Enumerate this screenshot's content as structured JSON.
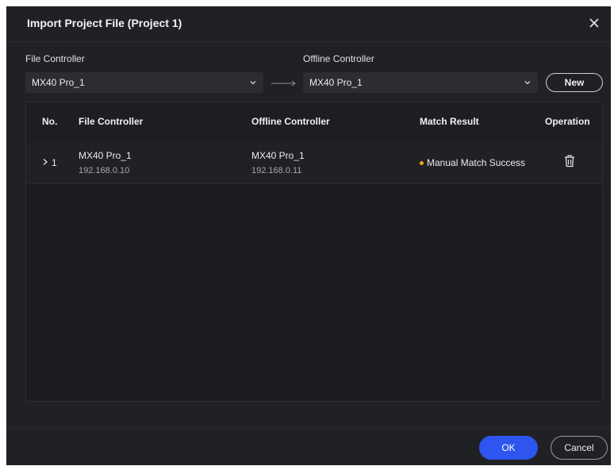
{
  "dialog": {
    "title": "Import Project File (Project 1)",
    "close_icon": "close-icon"
  },
  "file_controller": {
    "label": "File Controller",
    "selected": "MX40 Pro_1"
  },
  "offline_controller": {
    "label": "Offline Controller",
    "selected": "MX40 Pro_1"
  },
  "new_button": {
    "label": "New"
  },
  "table": {
    "headers": {
      "no": "No.",
      "file_controller": "File Controller",
      "offline_controller": "Offline Controller",
      "match_result": "Match Result",
      "operation": "Operation"
    },
    "rows": [
      {
        "no": "1",
        "file_controller_name": "MX40 Pro_1",
        "file_controller_ip": "192.168.0.10",
        "offline_controller_name": "MX40 Pro_1",
        "offline_controller_ip": "192.168.0.11",
        "match_result": "Manual Match Success",
        "match_status_color": "#f2a41c",
        "operation_icon": "trash-icon"
      }
    ]
  },
  "footer": {
    "ok_label": "OK",
    "cancel_label": "Cancel"
  },
  "colors": {
    "accent": "#2f55f0",
    "background": "#202124",
    "status_warning": "#f2a41c"
  }
}
